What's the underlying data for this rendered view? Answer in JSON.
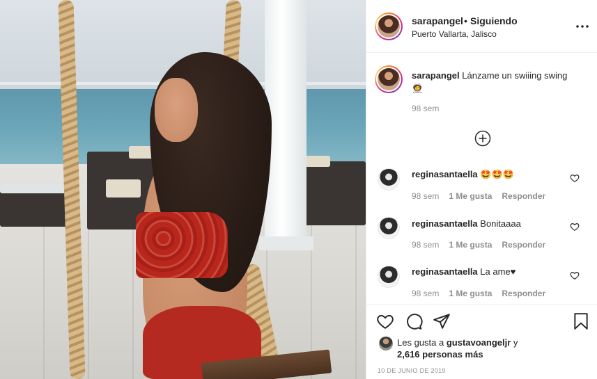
{
  "post": {
    "username": "sarapangel",
    "dot": "•",
    "follow_label": "Siguiendo",
    "location": "Puerto Vallarta, Jalisco",
    "more_icon": "more-options-icon",
    "caption": {
      "username": "sarapangel",
      "text": "Lánzame un swiiing swing",
      "emoji": "🧑‍🚀",
      "time": "98 sem"
    },
    "load_more_icon": "add-circle-icon"
  },
  "comments": [
    {
      "username": "reginasantaella",
      "text": "🤩🤩🤩",
      "time": "98 sem",
      "likes": "1 Me gusta",
      "reply": "Responder"
    },
    {
      "username": "reginasantaella",
      "text": "Bonitaaaa",
      "time": "98 sem",
      "likes": "1 Me gusta",
      "reply": "Responder"
    },
    {
      "username": "reginasantaella",
      "text": "La ame♥",
      "time": "98 sem",
      "likes": "1 Me gusta",
      "reply": "Responder"
    }
  ],
  "actions": {
    "like_icon": "heart-icon",
    "comment_icon": "comment-icon",
    "share_icon": "share-icon",
    "save_icon": "bookmark-icon"
  },
  "likes": {
    "prefix": "Les gusta a ",
    "user": "gustavoangeljr",
    "joiner": " y",
    "count": "2,616 personas más"
  },
  "date": "10 DE JUNIO DE 2019"
}
